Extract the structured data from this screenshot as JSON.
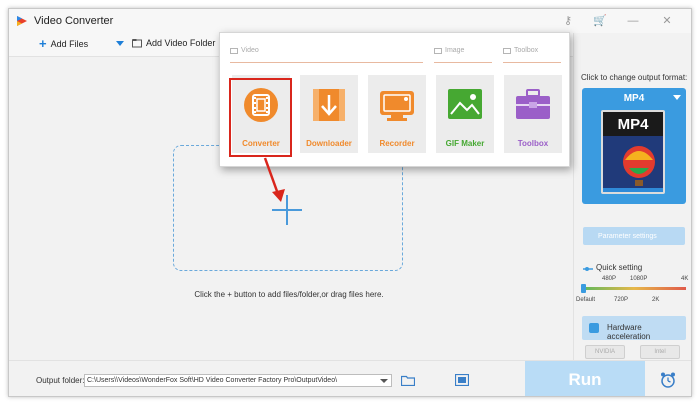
{
  "app": {
    "title": "Video Converter"
  },
  "toolbar": {
    "add_files": "Add Files",
    "add_video_folder": "Add Video Folder"
  },
  "popup": {
    "categories": {
      "video": "Video",
      "image": "Image",
      "toolbox": "Toolbox"
    },
    "tiles": [
      {
        "label": "Converter",
        "color": "#f08a2c",
        "icon": "film-icon"
      },
      {
        "label": "Downloader",
        "color": "#f08a2c",
        "icon": "download-icon"
      },
      {
        "label": "Recorder",
        "color": "#f08a2c",
        "icon": "screen-recorder-icon"
      },
      {
        "label": "GIF Maker",
        "color": "#46a832",
        "icon": "image-icon"
      },
      {
        "label": "Toolbox",
        "color": "#9b5fc8",
        "icon": "toolbox-icon"
      }
    ]
  },
  "main": {
    "drop_hint": "Click the + button to add files/folder,or drag files here."
  },
  "output": {
    "label": "Click to change output format:",
    "format": "MP4",
    "parameter_settings": "Parameter settings",
    "quick_setting": "Quick setting",
    "slider_top": [
      "480P",
      "1080P",
      "4K"
    ],
    "slider_bottom": [
      "Default",
      "720P",
      "2K"
    ],
    "hardware_acceleration": "Hardware acceleration",
    "chips": [
      "NVIDIA",
      "Intel"
    ]
  },
  "bottom": {
    "output_folder_label": "Output folder:",
    "output_folder_value": "C:\\Users\\\\Videos\\WonderFox Soft\\HD Video Converter Factory Pro\\OutputVideo\\",
    "run": "Run"
  },
  "colors": {
    "accent": "#3a9be0",
    "orange": "#f08a2c",
    "highlight": "#d9261c"
  }
}
